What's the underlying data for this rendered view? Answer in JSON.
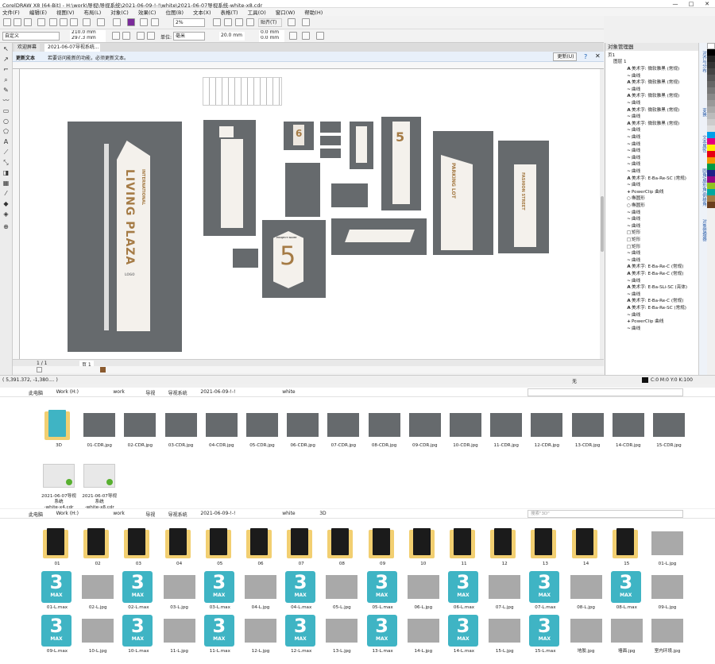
{
  "window": {
    "title": "CorelDRAW X8 (64-Bit) - H:\\work\\导视\\导视系统\\2021-06-09-!-!\\white\\2021-06-07导视系统-white-x8.cdr",
    "controls": [
      "—",
      "□",
      "✕"
    ]
  },
  "menu": [
    "文件(F)",
    "编辑(E)",
    "视图(V)",
    "布局(L)",
    "对象(C)",
    "效果(C)",
    "位图(B)",
    "文本(X)",
    "表格(T)",
    "工具(O)",
    "窗口(W)",
    "帮助(H)"
  ],
  "toolbar": {
    "zoom": "2%",
    "snap": "贴齐(T)"
  },
  "propbar": {
    "preset": "自定义",
    "width": "210.0 mm",
    "height": "297.3 mm",
    "units_label": "单位:",
    "units": "毫米",
    "nudge": "20.0 mm",
    "dup_x": "0.0 mm",
    "dup_y": "0.0 mm"
  },
  "tabs": {
    "welcome": "欢迎屏幕",
    "doc": "2021-06-07导视系统..."
  },
  "infobar": {
    "title": "更新文本",
    "message": "若要访问能新的功能，必须更新文本。",
    "button": "更新(U)"
  },
  "canvas": {
    "sign_line1": "INTERNATIONAL",
    "sign_line2": "LIVING PLAZA",
    "sign_small": "LOGO",
    "num5": "5",
    "num6": "6",
    "plaza_label": "PARKING LOT",
    "street": "FASHION STREET",
    "project": "PROJECT NAME"
  },
  "pagebar": {
    "page": "页 1",
    "counter": "1 / 1"
  },
  "status": {
    "coords": "( 5,391.372, -1,380.... )",
    "fill": "无",
    "color": "C:0 M:0 Y:0 K:100"
  },
  "docker": {
    "title": "对象管理器",
    "layer_root": "页1",
    "layer": "图层 1",
    "items": [
      {
        "icon": "A",
        "label": "美术字: 微软雅黑 (常规)"
      },
      {
        "icon": "~",
        "label": "曲线"
      },
      {
        "icon": "A",
        "label": "美术字: 微软雅黑 (常规)"
      },
      {
        "icon": "~",
        "label": "曲线"
      },
      {
        "icon": "A",
        "label": "美术字: 微软雅黑 (常规)"
      },
      {
        "icon": "~",
        "label": "曲线"
      },
      {
        "icon": "A",
        "label": "美术字: 微软雅黑 (常规)"
      },
      {
        "icon": "~",
        "label": "曲线"
      },
      {
        "icon": "A",
        "label": "美术字: 微软雅黑 (常规)"
      },
      {
        "icon": "~",
        "label": "曲线"
      },
      {
        "icon": "~",
        "label": "曲线"
      },
      {
        "icon": "~",
        "label": "曲线"
      },
      {
        "icon": "~",
        "label": "曲线"
      },
      {
        "icon": "~",
        "label": "曲线"
      },
      {
        "icon": "~",
        "label": "曲线"
      },
      {
        "icon": "~",
        "label": "曲线"
      },
      {
        "icon": "A",
        "label": "美术字: E-Ba-Re-SC (常规)"
      },
      {
        "icon": "~",
        "label": "曲线"
      },
      {
        "icon": "+",
        "label": "PowerClip 曲线"
      },
      {
        "icon": "○",
        "label": "椭圆形"
      },
      {
        "icon": "○",
        "label": "椭圆形"
      },
      {
        "icon": "~",
        "label": "曲线"
      },
      {
        "icon": "~",
        "label": "曲线"
      },
      {
        "icon": "~",
        "label": "曲线"
      },
      {
        "icon": "□",
        "label": "矩形"
      },
      {
        "icon": "□",
        "label": "矩形"
      },
      {
        "icon": "□",
        "label": "矩形"
      },
      {
        "icon": "~",
        "label": "曲线"
      },
      {
        "icon": "~",
        "label": "曲线"
      },
      {
        "icon": "A",
        "label": "美术字: E-Ba-Re-C (常规)"
      },
      {
        "icon": "A",
        "label": "美术字: E-Ba-Re-C (常规)"
      },
      {
        "icon": "~",
        "label": "曲线"
      },
      {
        "icon": "A",
        "label": "美术字: E-Ba-SLi-SC (亮体)"
      },
      {
        "icon": "~",
        "label": "曲线"
      },
      {
        "icon": "A",
        "label": "美术字: E-Ba-Re-C (常规)"
      },
      {
        "icon": "A",
        "label": "美术字: E-Ba-Re-SC (常规)"
      },
      {
        "icon": "~",
        "label": "曲线"
      },
      {
        "icon": "+",
        "label": "PowerClip 曲线"
      },
      {
        "icon": "~",
        "label": "曲线"
      }
    ]
  },
  "dock_tabs": [
    "对齐与分布",
    "变换",
    "文本属性",
    "圆角/扇形角/倒棱角",
    "对象管理器"
  ],
  "explorer1": {
    "crumbs": [
      "此电脑",
      "Work (H:)",
      "work",
      "导视",
      "导视系统",
      "2021-06-09-!-!",
      "white"
    ],
    "files": [
      "3D",
      "01-CDR.jpg",
      "02-CDR.jpg",
      "03-CDR.jpg",
      "04-CDR.jpg",
      "05-CDR.jpg",
      "06-CDR.jpg",
      "07-CDR.jpg",
      "08-CDR.jpg",
      "09-CDR.jpg",
      "10-CDR.jpg",
      "11-CDR.jpg",
      "12-CDR.jpg",
      "13-CDR.jpg",
      "14-CDR.jpg",
      "15-CDR.jpg"
    ],
    "cdr": [
      {
        "l1": "2021-06-07导视",
        "l2": "系统",
        "l3": "-white-x4.cdr"
      },
      {
        "l1": "2021-06-07导视",
        "l2": "系统",
        "l3": "-white-x8.cdr"
      }
    ]
  },
  "explorer2": {
    "crumbs": [
      "此电脑",
      "Work (H:)",
      "work",
      "导视",
      "导视系统",
      "2021-06-09-!-!",
      "white",
      "3D"
    ],
    "search": "搜索\"3D\"",
    "row1": [
      "01",
      "02",
      "03",
      "04",
      "05",
      "06",
      "07",
      "08",
      "09",
      "10",
      "11",
      "12",
      "13",
      "14",
      "15",
      "01-L.jpg"
    ],
    "row2": [
      "01-L.max",
      "02-L.jpg",
      "02-L.max",
      "03-L.jpg",
      "03-L.max",
      "04-L.jpg",
      "04-L.max",
      "05-L.jpg",
      "05-L.max",
      "06-L.jpg",
      "06-L.max",
      "07-L.jpg",
      "07-L.max",
      "08-L.jpg",
      "08-L.max",
      "09-L.jpg"
    ],
    "row3": [
      "09-L.max",
      "10-L.jpg",
      "10-L.max",
      "11-L.jpg",
      "11-L.max",
      "12-L.jpg",
      "12-L.max",
      "13-L.jpg",
      "13-L.max",
      "14-L.jpg",
      "14-L.max",
      "15-L.jpg",
      "15-L.max",
      "地胶.jpg",
      "墙面.jpg",
      "室内环境.jpg"
    ],
    "max_glyph": "3",
    "max_label": "MAX"
  }
}
